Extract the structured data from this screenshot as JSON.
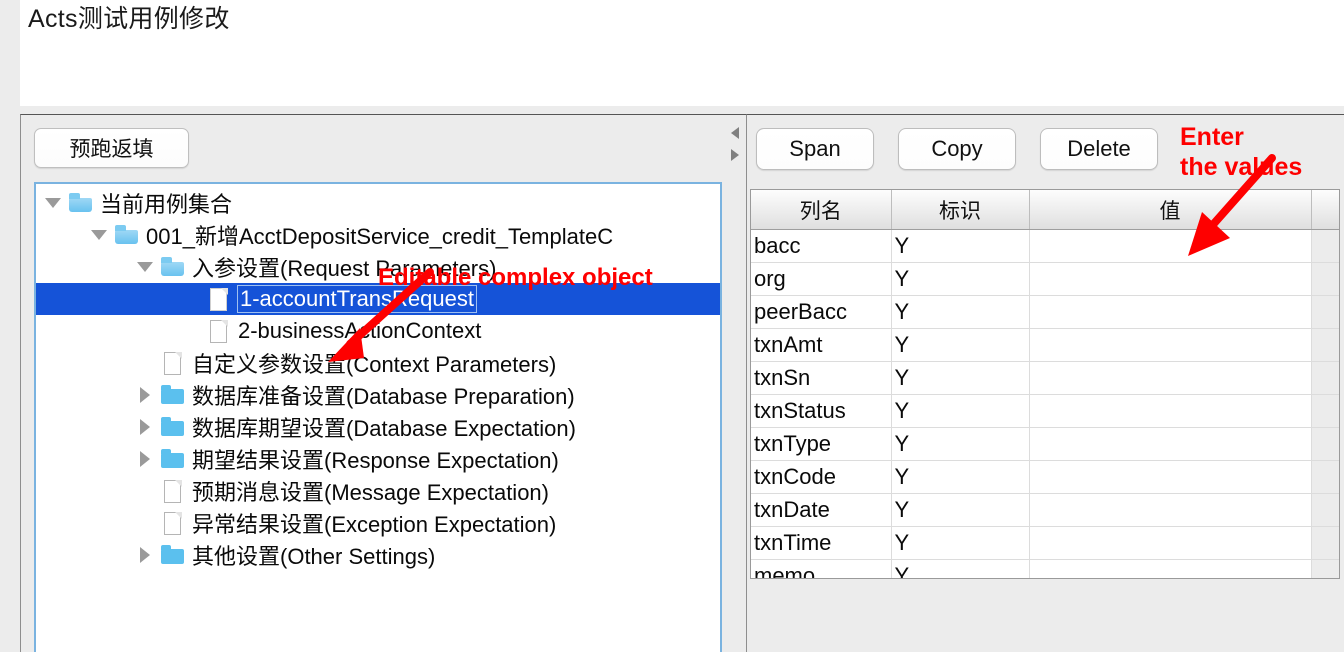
{
  "window": {
    "title": "Acts测试用例修改"
  },
  "left": {
    "prerun_button": "预跑返填",
    "splitter": {
      "collapse_left_icon": "triangle-left-icon",
      "collapse_right_icon": "triangle-right-icon"
    },
    "tree": [
      {
        "label": "当前用例集合",
        "depth": 0,
        "twisty": "down",
        "icon": "folder-open",
        "selected": false
      },
      {
        "label": "001_新增AcctDepositService_credit_TemplateC",
        "depth": 1,
        "twisty": "down",
        "icon": "folder-open",
        "selected": false
      },
      {
        "label": "入参设置(Request Parameters)",
        "depth": 2,
        "twisty": "down",
        "icon": "folder-open",
        "selected": false
      },
      {
        "label": "1-accountTransRequest",
        "depth": 3,
        "twisty": "none",
        "icon": "file",
        "selected": true
      },
      {
        "label": "2-businessActionContext",
        "depth": 3,
        "twisty": "none",
        "icon": "file",
        "selected": false
      },
      {
        "label": "自定义参数设置(Context Parameters)",
        "depth": 2,
        "twisty": "none",
        "icon": "file",
        "selected": false
      },
      {
        "label": "数据库准备设置(Database Preparation)",
        "depth": 2,
        "twisty": "right",
        "icon": "folder-closed",
        "selected": false
      },
      {
        "label": "数据库期望设置(Database Expectation)",
        "depth": 2,
        "twisty": "right",
        "icon": "folder-closed",
        "selected": false
      },
      {
        "label": "期望结果设置(Response Expectation)",
        "depth": 2,
        "twisty": "right",
        "icon": "folder-closed",
        "selected": false
      },
      {
        "label": "预期消息设置(Message Expectation)",
        "depth": 2,
        "twisty": "none",
        "icon": "file",
        "selected": false
      },
      {
        "label": "异常结果设置(Exception Expectation)",
        "depth": 2,
        "twisty": "none",
        "icon": "file",
        "selected": false
      },
      {
        "label": "其他设置(Other Settings)",
        "depth": 2,
        "twisty": "right",
        "icon": "folder-closed",
        "selected": false
      }
    ]
  },
  "right": {
    "toolbar": {
      "span": "Span",
      "copy": "Copy",
      "delete": "Delete"
    },
    "table": {
      "headers": [
        "列名",
        "标识",
        "值"
      ],
      "rows": [
        {
          "name": "bacc",
          "flag": "Y",
          "value": ""
        },
        {
          "name": "org",
          "flag": "Y",
          "value": ""
        },
        {
          "name": "peerBacc",
          "flag": "Y",
          "value": ""
        },
        {
          "name": "txnAmt",
          "flag": "Y",
          "value": ""
        },
        {
          "name": "txnSn",
          "flag": "Y",
          "value": ""
        },
        {
          "name": "txnStatus",
          "flag": "Y",
          "value": ""
        },
        {
          "name": "txnType",
          "flag": "Y",
          "value": ""
        },
        {
          "name": "txnCode",
          "flag": "Y",
          "value": ""
        },
        {
          "name": "txnDate",
          "flag": "Y",
          "value": ""
        },
        {
          "name": "txnTime",
          "flag": "Y",
          "value": ""
        },
        {
          "name": "memo",
          "flag": "Y",
          "value": ""
        }
      ]
    }
  },
  "annotations": {
    "left_note": "Editable complex object",
    "right_note_line1": "Enter",
    "right_note_line2": "the values",
    "color": "#fe0000"
  }
}
